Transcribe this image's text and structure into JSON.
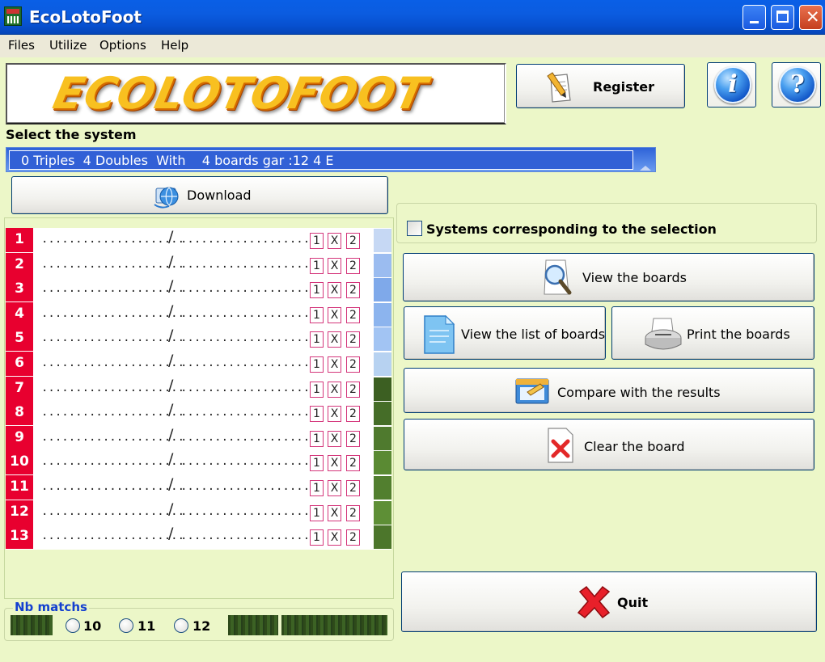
{
  "window": {
    "title": "EcoLotoFoot"
  },
  "menu": [
    "Files",
    "Utilize",
    "Options",
    "Help"
  ],
  "logo": {
    "text": "ECOLOTOFOOT"
  },
  "buttons": {
    "register": "Register",
    "download": "Download",
    "view_boards": "View the boards",
    "view_list": "View the list of boards",
    "print_boards": "Print the boards",
    "compare": "Compare with the results",
    "clear": "Clear the board",
    "quit": "Quit",
    "info_glyph": "i",
    "help_glyph": "?"
  },
  "system": {
    "label": "Select the system",
    "value": "0 Triples  4 Doubles  With    4 boards gar :12 4 E"
  },
  "systems_checkbox": {
    "label": "Systems corresponding to the selection",
    "checked": false
  },
  "matches": [
    {
      "num": "1",
      "home": ".....................",
      "sep": "/",
      "away": ".....................",
      "opts": [
        "1",
        "X",
        "2"
      ]
    },
    {
      "num": "2",
      "home": ".....................",
      "sep": "/",
      "away": ".....................",
      "opts": [
        "1",
        "X",
        "2"
      ]
    },
    {
      "num": "3",
      "home": ".....................",
      "sep": "/",
      "away": ".....................",
      "opts": [
        "1",
        "X",
        "2"
      ]
    },
    {
      "num": "4",
      "home": ".....................",
      "sep": "/",
      "away": ".....................",
      "opts": [
        "1",
        "X",
        "2"
      ]
    },
    {
      "num": "5",
      "home": ".....................",
      "sep": "/",
      "away": ".....................",
      "opts": [
        "1",
        "X",
        "2"
      ]
    },
    {
      "num": "6",
      "home": ".....................",
      "sep": "/",
      "away": ".....................",
      "opts": [
        "1",
        "X",
        "2"
      ]
    },
    {
      "num": "7",
      "home": ".....................",
      "sep": "/",
      "away": ".....................",
      "opts": [
        "1",
        "X",
        "2"
      ]
    },
    {
      "num": "8",
      "home": ".....................",
      "sep": "/",
      "away": ".....................",
      "opts": [
        "1",
        "X",
        "2"
      ]
    },
    {
      "num": "9",
      "home": ".....................",
      "sep": "/",
      "away": ".....................",
      "opts": [
        "1",
        "X",
        "2"
      ]
    },
    {
      "num": "10",
      "home": ".....................",
      "sep": "/",
      "away": ".....................",
      "opts": [
        "1",
        "X",
        "2"
      ]
    },
    {
      "num": "11",
      "home": ".....................",
      "sep": "/",
      "away": ".....................",
      "opts": [
        "1",
        "X",
        "2"
      ]
    },
    {
      "num": "12",
      "home": ".....................",
      "sep": "/",
      "away": ".....................",
      "opts": [
        "1",
        "X",
        "2"
      ]
    },
    {
      "num": "13",
      "home": ".....................",
      "sep": "/",
      "away": ".....................",
      "opts": [
        "1",
        "X",
        "2"
      ]
    }
  ],
  "nb_matchs": {
    "label": "Nb matchs",
    "options": [
      "10",
      "11",
      "12"
    ]
  },
  "colors": {
    "row_number": "#e8002f",
    "option_border": "#d4367b",
    "label_blue": "#1440d0",
    "select_bg": "#3160d6"
  }
}
